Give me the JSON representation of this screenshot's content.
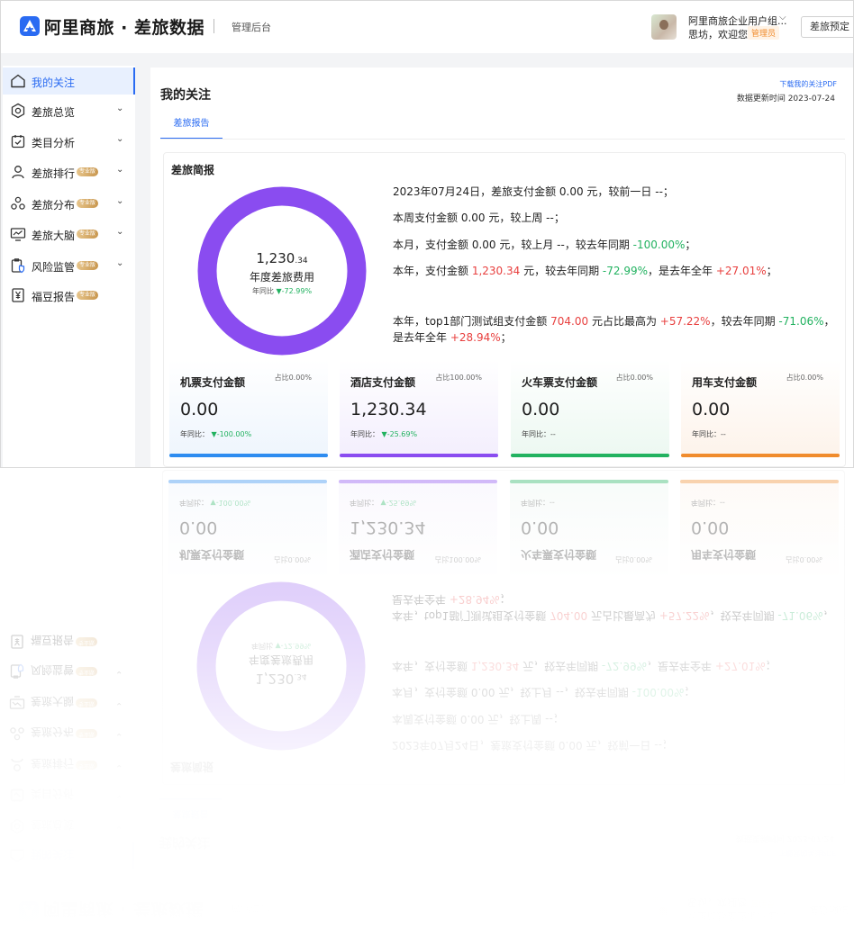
{
  "header": {
    "brand": "阿里商旅 · 差旅数据",
    "admin_label": "管理后台",
    "org_name": "阿里商旅企业用户组...",
    "greeting": "思坊，欢迎您",
    "role": "管理员",
    "book_button": "差旅预定"
  },
  "sidebar": {
    "items": [
      {
        "label": "我的关注",
        "icon": "home-icon",
        "active": true
      },
      {
        "label": "差旅总览",
        "icon": "target-icon",
        "chevron": true
      },
      {
        "label": "类目分析",
        "icon": "calendar-check-icon",
        "chevron": true
      },
      {
        "label": "差旅排行",
        "icon": "user-icon",
        "badge": "专业版",
        "chevron": true
      },
      {
        "label": "差旅分布",
        "icon": "nodes-icon",
        "badge": "专业版",
        "chevron": true
      },
      {
        "label": "差旅大脑",
        "icon": "monitor-chart-icon",
        "badge": "专业版",
        "chevron": true
      },
      {
        "label": "风险监管",
        "icon": "shield-clipboard-icon",
        "badge": "专业版",
        "chevron": true
      },
      {
        "label": "福豆报告",
        "icon": "yen-report-icon",
        "badge": "专业版"
      }
    ]
  },
  "main": {
    "title": "我的关注",
    "download_link": "下载我的关注PDF",
    "updated": "数据更新时间 2023-07-24",
    "tabs": [
      "差旅报告"
    ],
    "card_title": "差旅简报",
    "donut": {
      "value_main": "1,230",
      "value_decimal": ".34",
      "label": "年度差旅费用",
      "yoy_prefix": "年同比",
      "yoy_value": "▼-72.99%",
      "ring_color": "#8a4cf0"
    },
    "summary": {
      "line1": "2023年07月24日，差旅支付金额 0.00 元，较前一日 --；",
      "line2": "本周支付金额 0.00 元，较上周 --；",
      "line3_a": "本月，支付金额 0.00 元，较上月 --，较去年同期 ",
      "line3_b": "-100.00%",
      "line3_c": "；",
      "line4_a": "本年，支付金额 ",
      "line4_b": "1,230.34",
      "line4_c": " 元，较去年同期 ",
      "line4_d": "-72.99%",
      "line4_e": "，是去年全年 ",
      "line4_f": "+27.01%",
      "line4_g": "；",
      "line5_a": "本年，top1部门测试组支付金额 ",
      "line5_b": "704.00",
      "line5_c": " 元占比最高为 ",
      "line5_d": "+57.22%",
      "line5_e": "，较去年同期 ",
      "line5_f": "-71.06%",
      "line5_g": "，是去年全年 ",
      "line5_h": "+28.94%",
      "line5_i": "；"
    },
    "metrics": [
      {
        "title": "机票支付金额",
        "share": "占比0.00%",
        "value": "0.00",
        "yoy_label": "年同比：",
        "yoy": "▼-100.00%",
        "color": "#2d8cf0",
        "tint": "#eef5fd"
      },
      {
        "title": "酒店支付金额",
        "share": "占比100.00%",
        "value": "1,230.34",
        "yoy_label": "年同比：",
        "yoy": "▼-25.69%",
        "color": "#8a4cf0",
        "tint": "#f3eefd"
      },
      {
        "title": "火车票支付金额",
        "share": "占比0.00%",
        "value": "0.00",
        "yoy_label": "年同比：",
        "yoy": "--",
        "color": "#22b260",
        "tint": "#ecf8f1"
      },
      {
        "title": "用车支付金额",
        "share": "占比0.00%",
        "value": "0.00",
        "yoy_label": "年同比：",
        "yoy": "--",
        "color": "#f08c2d",
        "tint": "#fdf3ea"
      }
    ]
  }
}
